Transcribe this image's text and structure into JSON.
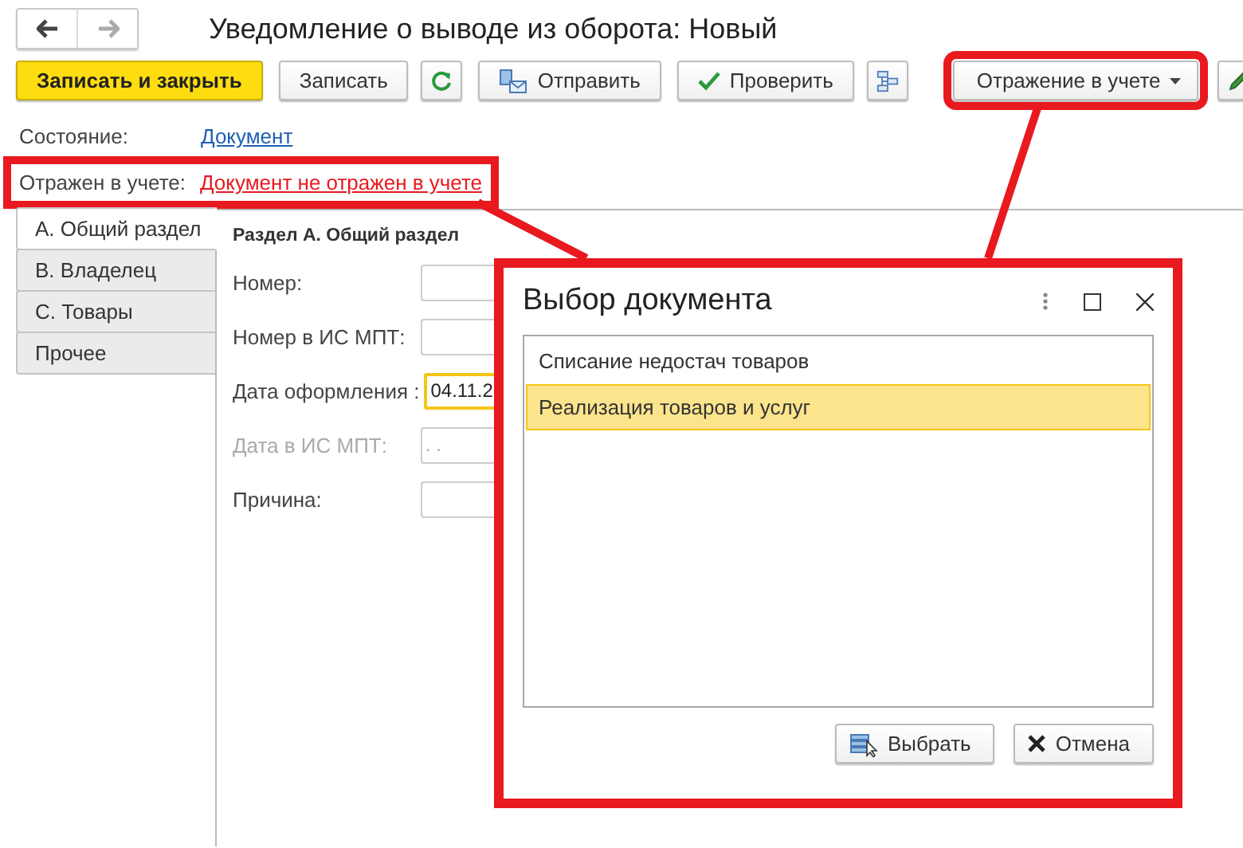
{
  "window": {
    "title": "Уведомление о выводе из оборота: Новый"
  },
  "nav": [
    {
      "kind": "back",
      "disabled": false
    },
    {
      "kind": "forward",
      "disabled": true
    }
  ],
  "toolbar": [
    {
      "kind": "primary",
      "label": "Записать и закрыть"
    },
    {
      "kind": "plain",
      "label": "Записать"
    },
    {
      "kind": "refresh"
    },
    {
      "kind": "send",
      "label": "Отправить"
    },
    {
      "kind": "check",
      "label": "Проверить"
    },
    {
      "kind": "structure"
    },
    {
      "kind": "dropdown",
      "label": "Отражение в учете",
      "highlighted": true
    },
    {
      "kind": "edit"
    }
  ],
  "status": [
    {
      "label": "Состояние:",
      "value": "Документ",
      "kind": "link",
      "highlighted": false
    },
    {
      "label": "Отражен в учете:",
      "value": "Документ не отражен в учете",
      "kind": "alert",
      "highlighted": true
    }
  ],
  "tabs": [
    {
      "label": "А. Общий раздел",
      "selected": true
    },
    {
      "label": "B. Владелец",
      "selected": false
    },
    {
      "label": "C. Товары",
      "selected": false
    },
    {
      "label": "Прочее",
      "selected": false
    }
  ],
  "section_title": "Раздел А. Общий раздел",
  "fields": [
    {
      "label": "Номер:",
      "disabled": false,
      "focused": false
    },
    {
      "label": "Номер в ИС МПТ:",
      "disabled": false,
      "focused": false
    },
    {
      "label": "Дата оформления :",
      "value": "04.11.2",
      "disabled": false,
      "focused": true
    },
    {
      "label": "Дата в ИС МПТ:",
      "placeholder": ". .",
      "disabled": true,
      "focused": false
    },
    {
      "label": "Причина:",
      "disabled": false,
      "focused": false
    }
  ],
  "dialog": {
    "title": "Выбор документа",
    "highlighted": true,
    "items": [
      {
        "label": "Списание недостач товаров",
        "selected": false
      },
      {
        "label": "Реализация товаров и услуг",
        "selected": true
      }
    ],
    "buttons": [
      {
        "kind": "choose",
        "label": "Выбрать"
      },
      {
        "kind": "cancel",
        "label": "Отмена"
      }
    ]
  }
}
